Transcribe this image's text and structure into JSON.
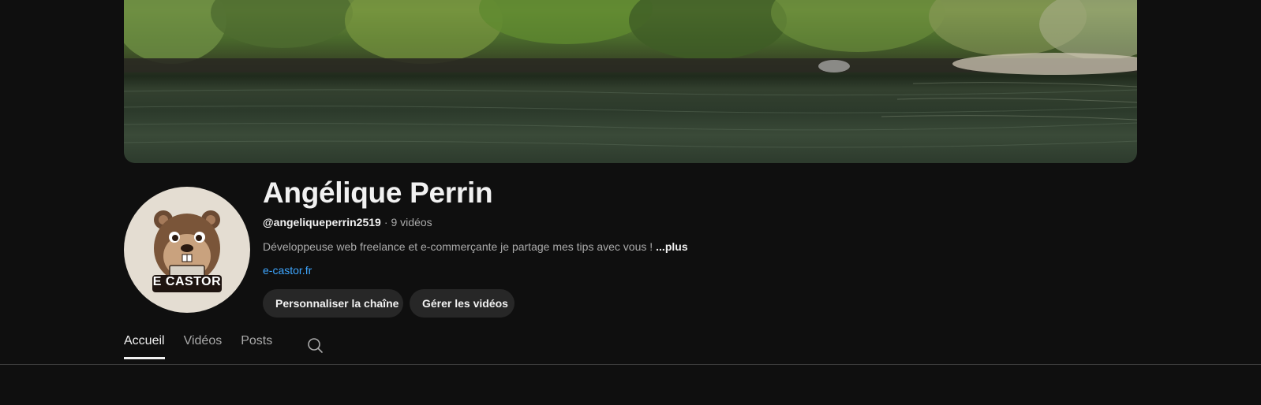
{
  "channel": {
    "name": "Angélique Perrin",
    "handle": "@angeliqueperrin2519",
    "separator": "·",
    "video_count": "9 vidéos",
    "description": "Développeuse web freelance et e-commerçante je partage mes tips avec vous !",
    "more_label": "...plus",
    "link": "e-castor.fr",
    "avatar_text": "E CASTOR"
  },
  "buttons": {
    "customize": "Personnaliser la chaîne",
    "manage": "Gérer les vidéos"
  },
  "tabs": [
    {
      "label": "Accueil",
      "active": true
    },
    {
      "label": "Vidéos",
      "active": false
    },
    {
      "label": "Posts",
      "active": false
    }
  ],
  "icons": {
    "search": "search-icon"
  },
  "colors": {
    "background": "#0f0f0f",
    "link": "#3ea6ff",
    "button_bg": "#272727",
    "avatar_bg": "#e4ddd2"
  }
}
